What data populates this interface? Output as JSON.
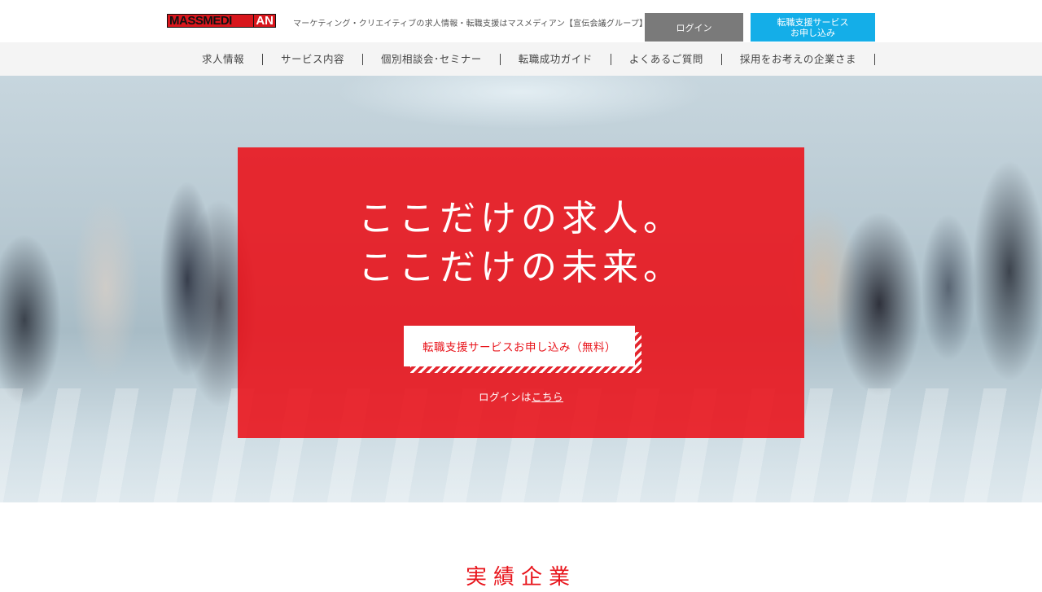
{
  "header": {
    "logo_mass": "MASSMEDI",
    "logo_an": "AN",
    "tagline": "マーケティング・クリエイティブの求人情報・転職支援はマスメディアン【宣伝会議グループ】",
    "login_label": "ログイン",
    "apply_line1": "転職支援サービス",
    "apply_line2": "お申し込み"
  },
  "nav": {
    "items": [
      {
        "label": "求人情報"
      },
      {
        "label": "サービス内容"
      },
      {
        "label": "個別相談会･セミナー"
      },
      {
        "label": "転職成功ガイド"
      },
      {
        "label": "よくあるご質問"
      },
      {
        "label": "採用をお考えの企業さま"
      }
    ]
  },
  "hero": {
    "title_line1": "ここだけの求人。",
    "title_line2": "ここだけの未来。",
    "cta_label": "転職支援サービスお申し込み（無料）",
    "login_prefix": "ログインは",
    "login_link": "こちら"
  },
  "section": {
    "title": "実績企業"
  },
  "colors": {
    "brand_red": "#e8141b",
    "login_gray": "#7a7a7a",
    "apply_blue": "#14aee8"
  }
}
